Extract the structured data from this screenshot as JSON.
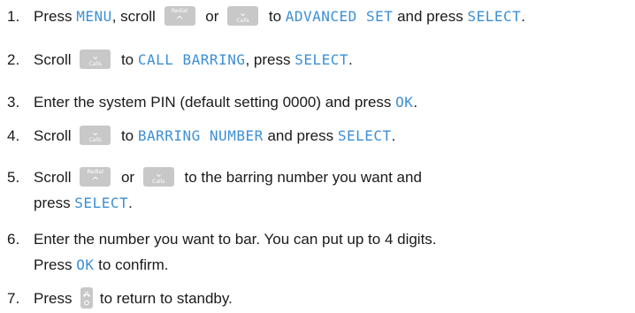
{
  "keys": {
    "redial_label": "Redial",
    "calls_label": "Calls",
    "up_arrow": "^",
    "down_arrow": "⌄",
    "end_icon": "phone-end-icon"
  },
  "colors": {
    "display_text": "#3d8fd4",
    "key_background": "#c8c8c8",
    "body_text": "#1a1a1a"
  },
  "steps": [
    {
      "number": "1.",
      "t1": "Press ",
      "d1": "MENU",
      "t2": ", scroll ",
      "t3": " or ",
      "t4": " to ",
      "d2": "ADVANCED SET",
      "t5": " and press ",
      "d3": "SELECT",
      "t6": "."
    },
    {
      "number": "2.",
      "t1": "Scroll ",
      "t2": " to ",
      "d1": "CALL BARRING",
      "t3": ", press ",
      "d2": "SELECT",
      "t4": "."
    },
    {
      "number": "3.",
      "t1": "Enter the system PIN (default setting 0000) and press ",
      "d1": "OK",
      "t2": "."
    },
    {
      "number": "4.",
      "t1": "Scroll ",
      "t2": " to ",
      "d1": "BARRING NUMBER",
      "t3": " and press ",
      "d2": "SELECT",
      "t4": "."
    },
    {
      "number": "5.",
      "t1": "Scroll ",
      "t2": " or ",
      "t3": " to the barring number you want and",
      "t4": "press ",
      "d1": "SELECT",
      "t5": "."
    },
    {
      "number": "6.",
      "t1": "Enter the number you want to bar. You can put up to 4 digits.",
      "t2": "Press ",
      "d1": "OK",
      "t3": " to confirm."
    },
    {
      "number": "7.",
      "t1": "Press ",
      "t2": " to return to standby."
    }
  ]
}
